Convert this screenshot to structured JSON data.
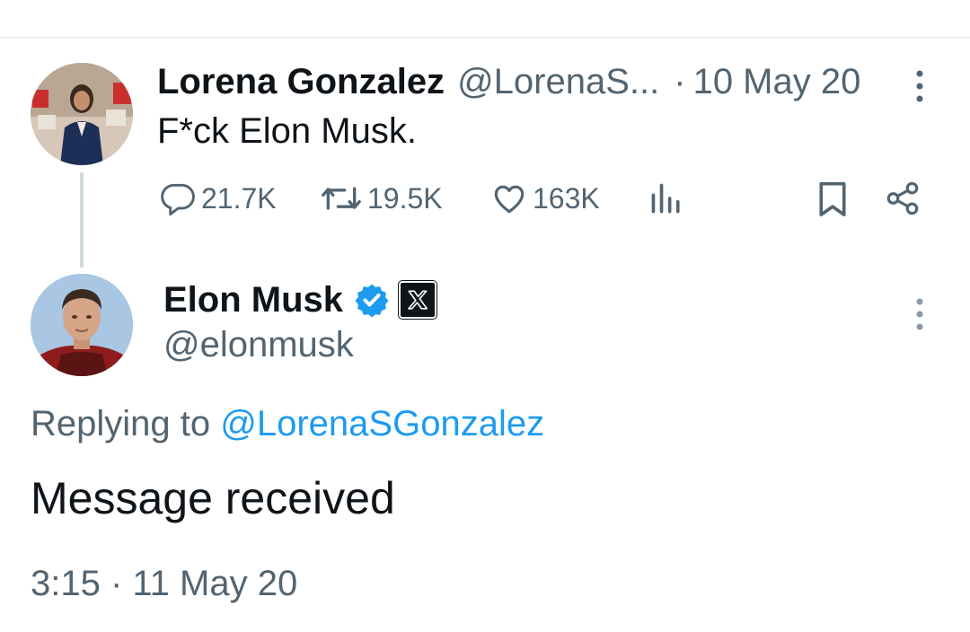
{
  "parent_tweet": {
    "author_name": "Lorena Gonzalez",
    "handle": "@LorenaS...",
    "separator": "·",
    "date": "10 May 20",
    "text": "F*ck Elon Musk.",
    "stats": {
      "replies": "21.7K",
      "reposts": "19.5K",
      "likes": "163K"
    },
    "icons": [
      "reply-icon",
      "repost-icon",
      "like-icon",
      "views-icon",
      "bookmark-icon",
      "share-icon",
      "more-icon"
    ]
  },
  "main_tweet": {
    "author_name": "Elon Musk",
    "handle": "@elonmusk",
    "replying_prefix": "Replying to",
    "replying_to": "@LorenaSGonzalez",
    "text": "Message received",
    "timestamp": "3:15 · 11 May 20",
    "badges": [
      "verified-badge-icon",
      "x-affiliation-icon"
    ]
  },
  "colors": {
    "text_primary": "#0f1419",
    "text_secondary": "#536471",
    "accent": "#1d9bf0",
    "thread_line": "#cfd9de"
  }
}
